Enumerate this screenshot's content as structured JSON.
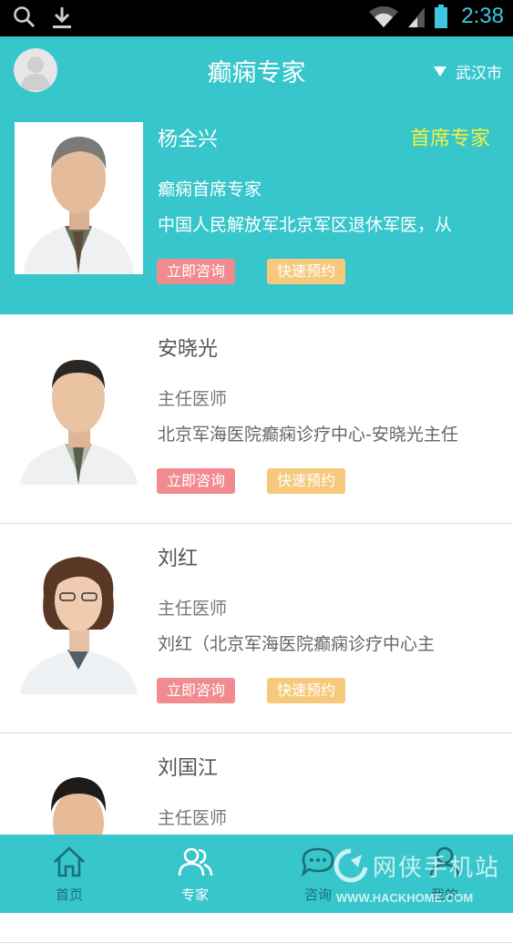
{
  "status_bar": {
    "time": "2:38"
  },
  "header": {
    "title": "癫痫专家",
    "city": "武汉市"
  },
  "doctors": [
    {
      "name": "杨全兴",
      "badge": "首席专家",
      "title": "癫痫首席专家",
      "description": "中国人民解放军北京军区退休军医，从",
      "consult_label": "立即咨询",
      "book_label": "快速预约"
    },
    {
      "name": "安晓光",
      "title": "主任医师",
      "description": "北京军海医院癫痫诊疗中心-安晓光主任",
      "consult_label": "立即咨询",
      "book_label": "快速预约"
    },
    {
      "name": "刘红",
      "title": "主任医师",
      "description": "刘红（北京军海医院癫痫诊疗中心主",
      "consult_label": "立即咨询",
      "book_label": "快速预约"
    },
    {
      "name": "刘国江",
      "title": "主任医师"
    }
  ],
  "bottom_nav": {
    "items": [
      {
        "label": "首页",
        "icon": "home-icon"
      },
      {
        "label": "专家",
        "icon": "experts-icon",
        "active": true
      },
      {
        "label": "咨询",
        "icon": "chat-icon"
      },
      {
        "label": "我的",
        "icon": "profile-icon"
      }
    ]
  },
  "watermark": {
    "text": "网侠手机站",
    "url": "WWW.HACKHOME.COM"
  },
  "colors": {
    "brand": "#36c6cb",
    "consult_button": "#f28b8f",
    "book_button": "#f6c97d",
    "badge": "#f3f03e"
  }
}
